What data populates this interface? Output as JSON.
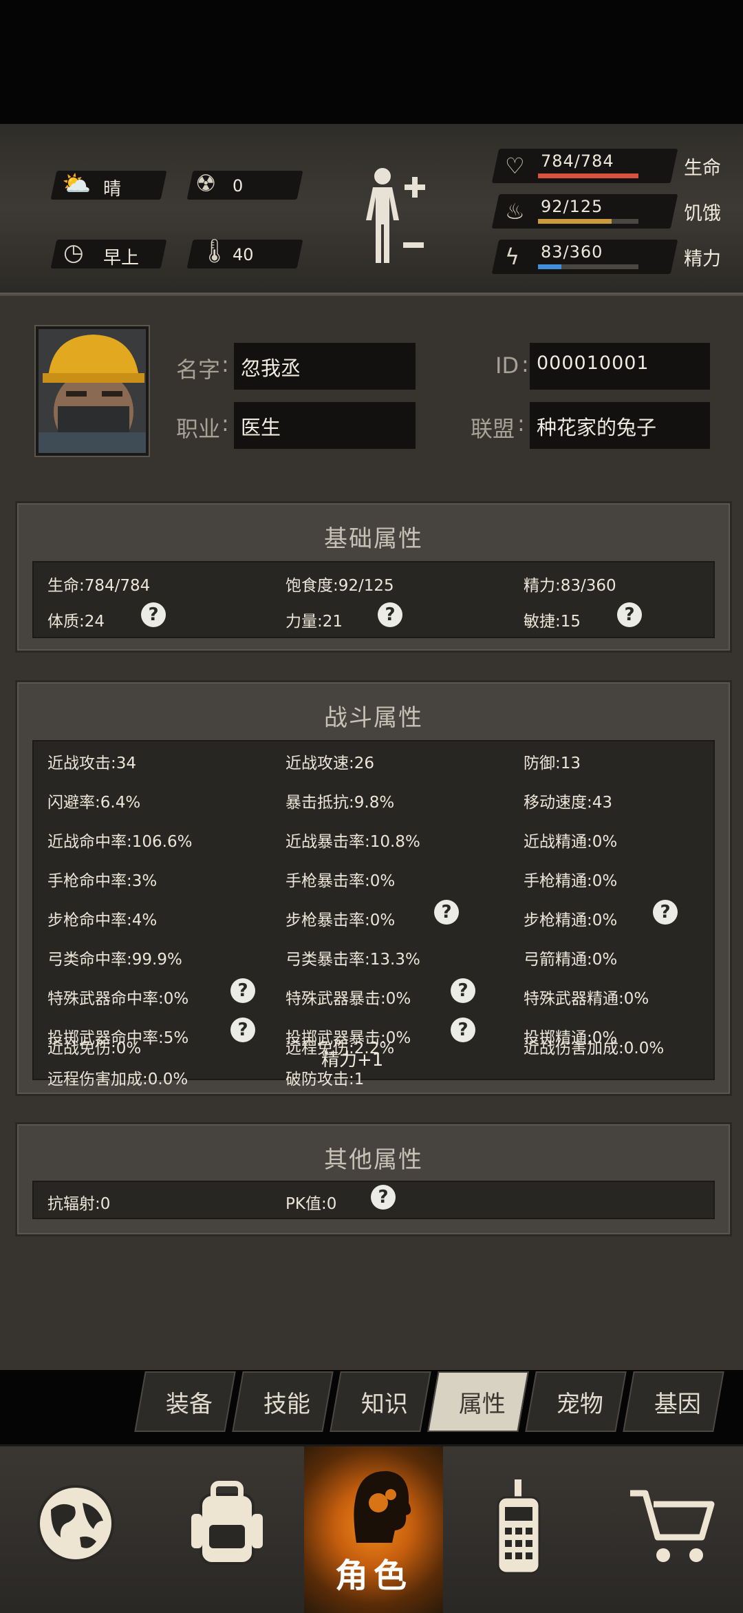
{
  "status": {
    "weather": "晴",
    "radiation": "0",
    "time_of_day": "早上",
    "temperature": "40"
  },
  "vitals": [
    {
      "label": "生命",
      "value": "784/784",
      "fraction": 1.0,
      "color": "#d9523f",
      "icon": "heart-icon"
    },
    {
      "label": "饥饿",
      "value": "92/125",
      "fraction": 0.736,
      "color": "#c99a3e",
      "icon": "stomach-icon"
    },
    {
      "label": "精力",
      "value": "83/360",
      "fraction": 0.231,
      "color": "#3f8fd9",
      "icon": "energy-icon"
    }
  ],
  "profile": {
    "name_label": "名字",
    "name_value": "忽我丞",
    "job_label": "职业",
    "job_value": "医生",
    "id_label": "ID",
    "id_value": "000010001",
    "alliance_label": "联盟",
    "alliance_value": "种花家的兔子"
  },
  "basic": {
    "title": "基础属性",
    "items": [
      "生命:784/784",
      "饱食度:92/125",
      "精力:83/360",
      "体质:24",
      "力量:21",
      "敏捷:15"
    ]
  },
  "combat": {
    "title": "战斗属性",
    "items": [
      "近战攻击:34",
      "近战攻速:26",
      "防御:13",
      "闪避率:6.4%",
      "暴击抵抗:9.8%",
      "移动速度:43",
      "近战命中率:106.6%",
      "近战暴击率:10.8%",
      "近战精通:0%",
      "手枪命中率:3%",
      "手枪暴击率:0%",
      "手枪精通:0%",
      "步枪命中率:4%",
      "步枪暴击率:0%",
      "步枪精通:0%",
      "弓类命中率:99.9%",
      "弓类暴击率:13.3%",
      "弓箭精通:0%",
      "特殊武器命中率:0%",
      "特殊武器暴击:0%",
      "特殊武器精通:0%",
      "投掷武器命中率:5%",
      "投掷武器暴击:0%",
      "投掷精通:0%",
      "近战免伤:0%",
      "远程免伤:2.2%",
      "近战伤害加成:0.0%",
      "远程伤害加成:0.0%",
      "破防攻击:1"
    ],
    "floating_text": "精力+1"
  },
  "other": {
    "title": "其他属性",
    "items": [
      "抗辐射:0",
      "PK值:0"
    ]
  },
  "tabs": [
    "装备",
    "技能",
    "知识",
    "属性",
    "宠物",
    "基因"
  ],
  "active_tab": "属性",
  "nav": {
    "active_label": "角色",
    "active_color": "#e8801a"
  }
}
